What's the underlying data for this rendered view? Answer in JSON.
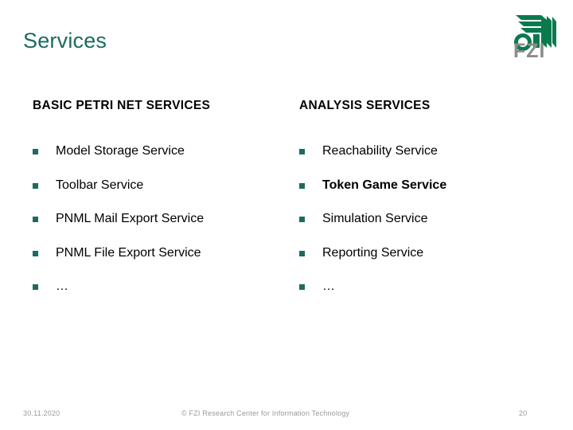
{
  "slide": {
    "title": "Services",
    "page_number": "20"
  },
  "brand": {
    "logo_icon": "fzi-fan-logo-icon",
    "wordmark": "FZI",
    "accent_green": "#057murky",
    "title_green": "#1d6b5e",
    "wordmark_gray": "#8c8c8c"
  },
  "columns": [
    {
      "header": "BASIC PETRI NET SERVICES",
      "items": [
        {
          "label": "Model Storage Service",
          "bold": false
        },
        {
          "label": "Toolbar Service",
          "bold": false
        },
        {
          "label": "PNML Mail Export Service",
          "bold": false
        },
        {
          "label": "PNML File Export Service",
          "bold": false
        },
        {
          "label": "…",
          "bold": false
        }
      ]
    },
    {
      "header": "ANALYSIS SERVICES",
      "items": [
        {
          "label": "Reachability Service",
          "bold": false
        },
        {
          "label": "Token Game Service",
          "bold": true
        },
        {
          "label": "Simulation Service",
          "bold": false
        },
        {
          "label": "Reporting Service",
          "bold": false
        },
        {
          "label": "…",
          "bold": false
        }
      ]
    }
  ],
  "footer": {
    "date": "30.11.2020",
    "copyright": "© FZI Research Center for Information Technology",
    "page_number": "20"
  }
}
